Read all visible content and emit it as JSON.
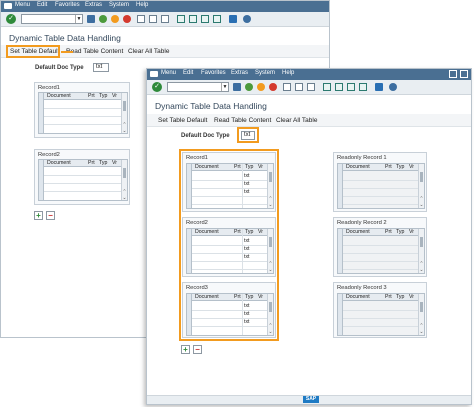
{
  "menu": {
    "items": [
      "Menu",
      "Edit",
      "Favorites",
      "Extras",
      "System",
      "Help"
    ]
  },
  "screen_title": "Dynamic Table Data Handling",
  "app_buttons": {
    "set": "Set Table Default",
    "read": "Read Table Content",
    "clear": "Clear All Table"
  },
  "default_doc": {
    "label": "Default Doc Type",
    "value": "txt"
  },
  "columns": {
    "document": "Document",
    "prt": "Prt",
    "typ": "Typ",
    "vr": "Vr"
  },
  "back_window": {
    "records": [
      "Record1",
      "Record2"
    ]
  },
  "front_window": {
    "records": [
      {
        "title": "Record1",
        "rows": [
          "txt",
          "txt",
          "txt"
        ]
      },
      {
        "title": "Record2",
        "rows": [
          "txt",
          "txt",
          "txt"
        ]
      },
      {
        "title": "Record3",
        "rows": [
          "txt",
          "txt",
          "txt"
        ]
      }
    ],
    "readonly": [
      "Readonly Record 1",
      "Readonly Record 2",
      "Readonly Record 3"
    ]
  },
  "icons": {
    "ok": "check-circle-icon",
    "save": "save-icon",
    "back": "back-icon",
    "exit": "exit-icon",
    "cancel": "cancel-icon",
    "print": "print-icon",
    "find": "find-icon",
    "page_nav": "page-nav-icons",
    "layout": "layout-icon",
    "help": "help-icon",
    "add_row": "plus-icon",
    "delete_row": "minus-icon"
  },
  "brand": {
    "logo": "SAP"
  },
  "colors": {
    "highlight": "#f29b1f",
    "menubar": "#4a6f92",
    "ok": "#2e8a3a",
    "add": "#2f8a3a",
    "delete": "#c62f2f"
  }
}
